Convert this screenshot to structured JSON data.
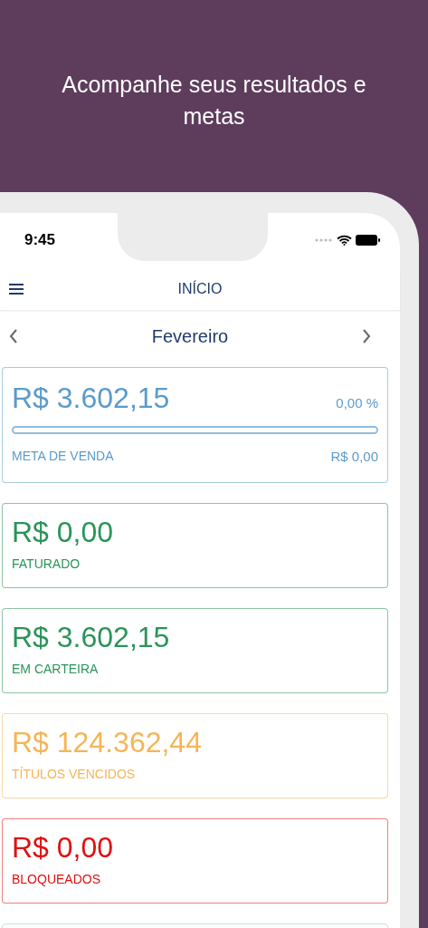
{
  "headline": "Acompanhe seus resultados e metas",
  "status_bar": {
    "time": "9:45"
  },
  "header": {
    "title": "INÍCIO"
  },
  "month_selector": {
    "month": "Fevereiro"
  },
  "cards": [
    {
      "kind": "goal",
      "amount": "R$ 3.602,15",
      "label": "META DE VENDA",
      "percent": "0,00 %",
      "target": "R$ 0,00",
      "level": 0,
      "color": "#5a9bcb"
    },
    {
      "kind": "amount",
      "amount": "R$ 0,00",
      "label": "FATURADO",
      "color": "#2a9459"
    },
    {
      "kind": "amount",
      "amount": "R$ 3.602,15",
      "label": "EM CARTEIRA",
      "color": "#2a9459"
    },
    {
      "kind": "amount",
      "amount": "R$ 124.362,44",
      "label": "TÍTULOS VENCIDOS",
      "color": "#f5b556"
    },
    {
      "kind": "amount",
      "amount": "R$ 0,00",
      "label": "BLOQUEADOS",
      "color": "#e01010"
    }
  ]
}
